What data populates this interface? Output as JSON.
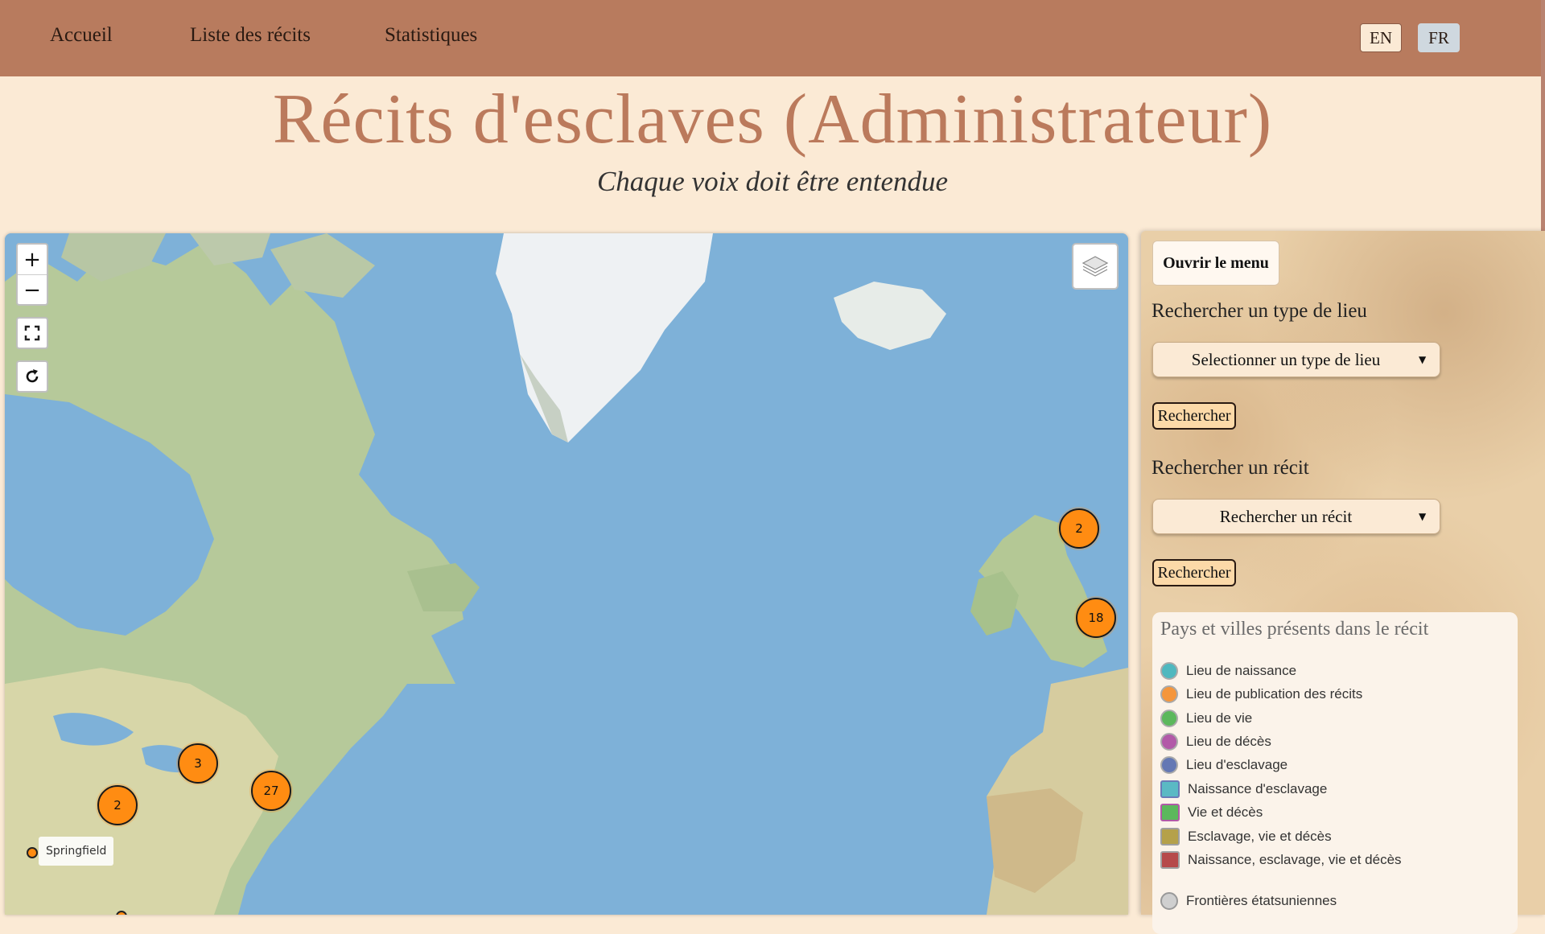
{
  "nav": {
    "home": "Accueil",
    "list": "Liste des récits",
    "stats": "Statistiques",
    "lang_en": "EN",
    "lang_fr": "FR",
    "active_lang": "FR"
  },
  "header": {
    "title": "Récits d'esclaves (Administrateur)",
    "subtitle": "Chaque voix doit être entendue"
  },
  "map": {
    "zoom_in": "+",
    "zoom_out": "−",
    "clusters": [
      "2",
      "18",
      "3",
      "27",
      "2"
    ],
    "labels": [
      "Springfield"
    ]
  },
  "panel": {
    "menu_button": "Ouvrir le menu",
    "place_type_heading": "Rechercher un type de lieu",
    "place_type_select": "Selectionner un type de lieu",
    "search_button_1": "Rechercher",
    "narrative_heading": "Rechercher un récit",
    "narrative_select": "Rechercher un récit",
    "search_button_2": "Rechercher"
  },
  "legend": {
    "title": "Pays et villes présents dans le récit",
    "items": [
      {
        "label": "Lieu de naissance",
        "color": "#4fb8bf",
        "shape": "circle"
      },
      {
        "label": "Lieu de publication des récits",
        "color": "#f5963c",
        "shape": "circle"
      },
      {
        "label": "Lieu de vie",
        "color": "#5cb85c",
        "shape": "circle"
      },
      {
        "label": "Lieu de décès",
        "color": "#b25aa8",
        "shape": "circle"
      },
      {
        "label": "Lieu d'esclavage",
        "color": "#6478b4",
        "shape": "circle"
      },
      {
        "label": "Naissance d'esclavage",
        "color": "#5ab9c4",
        "shape": "square"
      },
      {
        "label": "Vie et décès",
        "color": "#9e6fa8",
        "shape": "square"
      },
      {
        "label": "Esclavage, vie et décès",
        "color": "#b5a14a",
        "shape": "square"
      },
      {
        "label": "Naissance, esclavage, vie et décès",
        "color": "#b64a4a",
        "shape": "square"
      },
      {
        "label": "Frontières étatsuniennes",
        "color": "#cfcfcf",
        "shape": "circle"
      }
    ]
  },
  "colors": {
    "nav_bg": "#b87b5e",
    "page_bg": "#fbead5",
    "title": "#bb7a5c",
    "cluster": "#ff8c12"
  }
}
